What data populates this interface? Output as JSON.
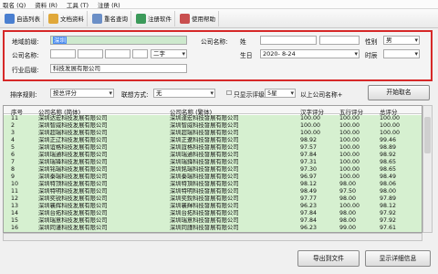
{
  "menu": [
    "取名 (Q)",
    "资料 (R)",
    "工具 (T)",
    "注册 (R)"
  ],
  "toolbar": [
    {
      "label": "自选列表",
      "icon": "list-icon",
      "color": "#4a7fd0"
    },
    {
      "label": "文档资料",
      "icon": "folder-icon",
      "color": "#e0a83a"
    },
    {
      "label": "重名查询",
      "icon": "search-doc-icon",
      "color": "#6b8fc7"
    },
    {
      "label": "注册软件",
      "icon": "cart-icon",
      "color": "#3b9a5a"
    },
    {
      "label": "使用帮助",
      "icon": "help-icon",
      "color": "#c94f4f"
    }
  ],
  "form": {
    "region_label": "地域前缀:",
    "region_value": "深圳",
    "company_name_label": "公司名称:",
    "industry_dropdown": "二字",
    "industry_label": "行业后缀:",
    "industry_value": "科技发展有限公司",
    "person_label": "公司名称:",
    "surname_label": "姓",
    "given_label": "名",
    "gender_label": "性别",
    "gender_value": "男",
    "birth_label": "生日",
    "birth_value": "2020- 8-24",
    "time_label": "时辰",
    "time_value": ""
  },
  "options": {
    "sort_label": "排序规则:",
    "sort_value": "按总评分",
    "associate_label": "联想方式:",
    "associate_value": "无",
    "only_show_label": "只显示评级",
    "only_show_value": "5星",
    "above_label": "以上公司名称+",
    "start_button": "开始取名"
  },
  "table": {
    "headers": [
      "序号",
      "公司名称 (简体)",
      "公司名称 (繁体)",
      "汉字评分",
      "五行评分",
      "总评分"
    ],
    "rows": [
      [
        "11",
        "深圳达宏科技发展有限公司",
        "深圳達宏科技發展有限公司",
        "100.00",
        "100.00",
        "100.00"
      ],
      [
        "2",
        "深圳智威科技发展有限公司",
        "深圳智威科技發展有限公司",
        "100.00",
        "100.00",
        "100.00"
      ],
      [
        "3",
        "深圳超瑞科技发展有限公司",
        "深圳超瑞科技發展有限公司",
        "100.00",
        "100.00",
        "100.00"
      ],
      [
        "4",
        "深圳正辽科技发展有限公司",
        "深圳正遼科技發展有限公司",
        "98.92",
        "100.00",
        "99.46"
      ],
      [
        "5",
        "深圳谊格科技发展有限公司",
        "深圳誼格科技發展有限公司",
        "97.57",
        "100.00",
        "98.89"
      ],
      [
        "6",
        "深圳瑞通科技发展有限公司",
        "深圳瑞通科技發展有限公司",
        "97.84",
        "100.00",
        "98.92"
      ],
      [
        "7",
        "深圳瑞锋科技发展有限公司",
        "深圳瑞鋒科技發展有限公司",
        "97.31",
        "100.00",
        "98.65"
      ],
      [
        "8",
        "深圳铭瑞科技发展有限公司",
        "深圳銘瑞科技發展有限公司",
        "97.30",
        "100.00",
        "98.65"
      ],
      [
        "9",
        "深圳秦瑞科技发展有限公司",
        "深圳秦瑞科技發展有限公司",
        "96.97",
        "100.00",
        "98.49"
      ],
      [
        "10",
        "深圳特顶科技发展有限公司",
        "深圳特頂科技發展有限公司",
        "98.12",
        "98.00",
        "98.06"
      ],
      [
        "11",
        "深圳特明科技发展有限公司",
        "深圳特明科技發展有限公司",
        "98.49",
        "97.50",
        "98.00"
      ],
      [
        "12",
        "深圳奕锐科技发展有限公司",
        "深圳奕銳科技發展有限公司",
        "97.77",
        "98.00",
        "97.89"
      ],
      [
        "13",
        "深圳襄辉科技发展有限公司",
        "深圳襄輝科技發展有限公司",
        "96.23",
        "100.00",
        "98.12"
      ],
      [
        "14",
        "深圳台拓科技发展有限公司",
        "深圳台拓科技發展有限公司",
        "97.84",
        "98.00",
        "97.92"
      ],
      [
        "15",
        "深圳瑞意科技发展有限公司",
        "深圳瑞意科技發展有限公司",
        "97.84",
        "98.00",
        "97.92"
      ],
      [
        "16",
        "深圳同谨科技发展有限公司",
        "深圳同謹科技發展有限公司",
        "96.23",
        "99.00",
        "97.61"
      ]
    ]
  },
  "footer": {
    "export_button": "导出到文件",
    "detail_button": "显示详细信息"
  },
  "colors": {
    "row_green": "#d6f0d0",
    "highlight_red": "#d62828",
    "selection_blue": "#4a8cf0"
  }
}
